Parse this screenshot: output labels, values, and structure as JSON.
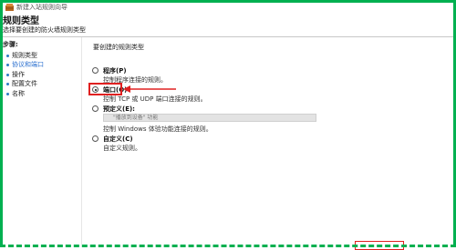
{
  "window": {
    "title": "新建入站规则向导"
  },
  "header": {
    "title": "规则类型",
    "description": "选择要创建的防火墙规则类型"
  },
  "steps": {
    "title": "步骤:",
    "items": [
      {
        "label": "规则类型",
        "current": false
      },
      {
        "label": "协议和端口",
        "current": true
      },
      {
        "label": "操作",
        "current": false
      },
      {
        "label": "配置文件",
        "current": false
      },
      {
        "label": "名称",
        "current": false
      }
    ]
  },
  "main": {
    "question": "要创建的规则类型",
    "options": [
      {
        "label": "程序(P)",
        "description": "控制程序连接的规则。",
        "selected": false
      },
      {
        "label": "端口(O)",
        "description": "控制 TCP 或 UDP 端口连接的规则。",
        "selected": true
      },
      {
        "label": "预定义(E):",
        "description": "控制 Windows 体验功能连接的规则。",
        "selected": false
      },
      {
        "label": "自定义(C)",
        "description": "自定义规则。",
        "selected": false
      }
    ],
    "predefined_select_value": "\"播放到设备\" 功能"
  },
  "colors": {
    "frame": "#00b050",
    "highlight": "#e02020",
    "step_current": "#2a6fcf"
  }
}
